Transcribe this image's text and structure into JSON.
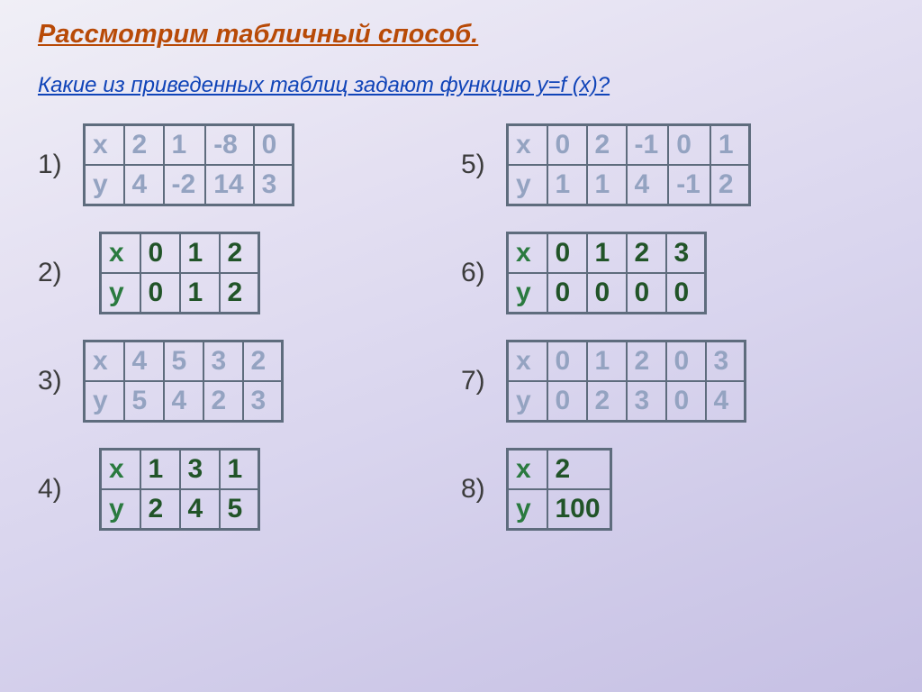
{
  "title": "Рассмотрим табличный способ.",
  "subtitle": "Какие из приведенных таблиц задают функцию y=f (x)?",
  "tables": {
    "t1": {
      "num": "1)",
      "style": "blue",
      "rows": [
        [
          "x",
          "2",
          "1",
          "-8",
          "0"
        ],
        [
          "y",
          "4",
          "-2",
          "14",
          "3"
        ]
      ]
    },
    "t2": {
      "num": "2)",
      "style": "green",
      "rows": [
        [
          "x",
          "0",
          "1",
          "2"
        ],
        [
          "y",
          "0",
          "1",
          "2"
        ]
      ]
    },
    "t3": {
      "num": "3)",
      "style": "blue",
      "rows": [
        [
          "x",
          "4",
          "5",
          "3",
          "2"
        ],
        [
          "y",
          "5",
          "4",
          "2",
          "3"
        ]
      ]
    },
    "t4": {
      "num": "4)",
      "style": "green",
      "rows": [
        [
          "x",
          "1",
          "3",
          "1"
        ],
        [
          "y",
          "2",
          "4",
          "5"
        ]
      ]
    },
    "t5": {
      "num": "5)",
      "style": "blue",
      "rows": [
        [
          "x",
          "0",
          "2",
          "-1",
          "0",
          "1"
        ],
        [
          "y",
          "1",
          "1",
          "4",
          "-1",
          "2"
        ]
      ]
    },
    "t6": {
      "num": "6)",
      "style": "green",
      "rows": [
        [
          "x",
          "0",
          "1",
          "2",
          "3"
        ],
        [
          "y",
          "0",
          "0",
          "0",
          "0"
        ]
      ]
    },
    "t7": {
      "num": "7)",
      "style": "blue",
      "rows": [
        [
          "x",
          "0",
          "1",
          "2",
          "0",
          "3"
        ],
        [
          "y",
          "0",
          "2",
          "3",
          "0",
          "4"
        ]
      ]
    },
    "t8": {
      "num": "8)",
      "style": "green",
      "rows": [
        [
          "x",
          "2"
        ],
        [
          "y",
          "100"
        ]
      ]
    }
  }
}
